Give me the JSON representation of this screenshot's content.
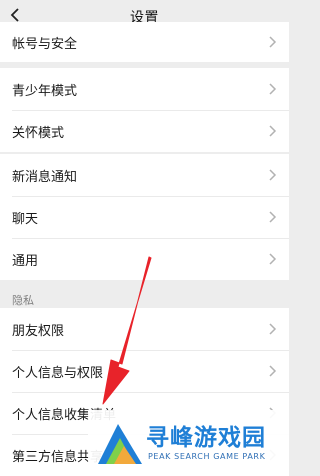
{
  "header": {
    "title": "设置"
  },
  "groups": {
    "account": [
      "帐号与安全"
    ],
    "modes": [
      "青少年模式",
      "关怀模式"
    ],
    "general": [
      "新消息通知",
      "聊天",
      "通用"
    ],
    "privacy_label": "隐私",
    "privacy": [
      "朋友权限",
      "个人信息与权限",
      "个人信息收集清单",
      "第三方信息共享清单"
    ]
  },
  "watermark": {
    "title": "寻峰游戏园",
    "subtitle": "PEAK SEARCH GAME PARK"
  },
  "colors": {
    "arrow": "#e8232a",
    "accent": "#1f7fd6"
  }
}
